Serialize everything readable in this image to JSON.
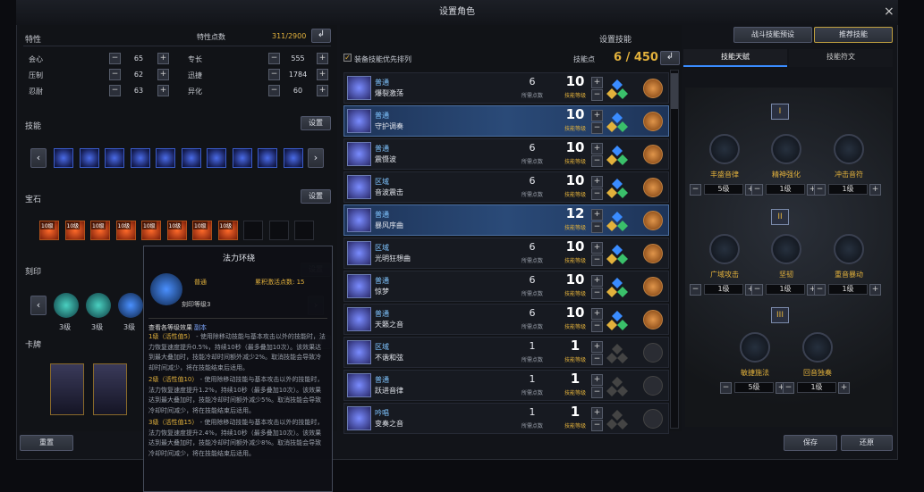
{
  "window": {
    "title": "设置角色",
    "close": "×"
  },
  "left": {
    "traits": {
      "title": "特性",
      "points_label": "特性点数",
      "points_value": "311/2900",
      "stats": [
        {
          "label": "会心",
          "value": "65"
        },
        {
          "label": "专长",
          "value": "555"
        },
        {
          "label": "压制",
          "value": "62"
        },
        {
          "label": "迅捷",
          "value": "1784"
        },
        {
          "label": "忍耐",
          "value": "63"
        },
        {
          "label": "异化",
          "value": "60"
        }
      ]
    },
    "skills": {
      "title": "技能",
      "button": "设置"
    },
    "gems": {
      "title": "宝石",
      "button": "设置",
      "labels": [
        "10级",
        "10级",
        "10级",
        "10级",
        "10级",
        "10级",
        "10级",
        "10级"
      ]
    },
    "engrave": {
      "title": "刻印",
      "button": "设置",
      "levels": [
        "3级",
        "3级",
        "3级"
      ]
    },
    "cards": {
      "title": "卡牌",
      "button": "设置"
    },
    "reset": "重置"
  },
  "tooltip": {
    "title": "法力环绕",
    "type": "普通",
    "points": "累积激活点数: 15",
    "level": "刻印等级3",
    "detail_link": "查看各等级效果",
    "detail_tag": "副本",
    "lines": [
      {
        "h": "1级（活性值5）",
        "t": " - 使用除移动技能与基本攻击以外的技能时，法力恢复速度提升0.5%，持续10秒（最多叠加10次）。该效果达到最大叠加时，技能冷却时间额外减少2%。取消技能会导致冷却时间减少，将在技能结束后适用。"
      },
      {
        "h": "2级（活性值10）",
        "t": " - 使用除移动技能与基本攻击以外的技能时，法力恢复速度提升1.2%，持续10秒（最多叠加10次）。该效果达到最大叠加时，技能冷却时间额外减少5%。取消技能会导致冷却时间减少，将在技能结束后适用。"
      },
      {
        "h": "3级（活性值15）",
        "t": " - 使用除移动技能与基本攻击以外的技能时，法力恢复速度提升2.4%，持续10秒（最多叠加10次）。该效果达到最大叠加时，技能冷却时间额外减少8%。取消技能会导致冷却时间减少，将在技能结束后适用。"
      }
    ]
  },
  "middle": {
    "title": "设置技能",
    "priority_label": "装备技能优先排列",
    "points_label": "技能点",
    "points_value": "6 / 450",
    "skills": [
      {
        "type": "普通",
        "name": "爆裂激荡",
        "points": "6",
        "level": "10",
        "coin": true
      },
      {
        "type": "普通",
        "name": "守护调奏",
        "points": "",
        "level": "10",
        "coin": true
      },
      {
        "type": "普通",
        "name": "震慑波",
        "points": "6",
        "level": "10",
        "coin": true
      },
      {
        "type": "区域",
        "name": "音波震击",
        "points": "6",
        "level": "10",
        "coin": true
      },
      {
        "type": "普通",
        "name": "暴风序曲",
        "points": "",
        "level": "12",
        "coin": true
      },
      {
        "type": "区域",
        "name": "光明狂想曲",
        "points": "6",
        "level": "10",
        "coin": true
      },
      {
        "type": "普通",
        "name": "惊梦",
        "points": "6",
        "level": "10",
        "coin": true
      },
      {
        "type": "普通",
        "name": "天籁之音",
        "points": "6",
        "level": "10",
        "coin": true
      },
      {
        "type": "区域",
        "name": "不谐和弦",
        "points": "1",
        "level": "1",
        "coin": false
      },
      {
        "type": "普通",
        "name": "跃进音律",
        "points": "1",
        "level": "1",
        "coin": false
      },
      {
        "type": "吟唱",
        "name": "变奏之音",
        "points": "1",
        "level": "1",
        "coin": false
      }
    ],
    "pts_label": "所需点数",
    "lv_label": "技能等级"
  },
  "right": {
    "buttons": {
      "preset": "战斗技能预设",
      "recommend": "推荐技能"
    },
    "tabs": {
      "talent": "技能天赋",
      "rune": "技能符文"
    },
    "tier1": [
      {
        "name": "丰盛音律",
        "lv": "5级"
      },
      {
        "name": "精神强化",
        "lv": "1级"
      },
      {
        "name": "冲击音符",
        "lv": "1级"
      }
    ],
    "tier2": [
      {
        "name": "广域攻击",
        "lv": "1级"
      },
      {
        "name": "坚韧",
        "lv": "1级"
      },
      {
        "name": "重音暴动",
        "lv": "1级"
      }
    ],
    "tier3": [
      {
        "name": "敏捷施法",
        "lv": "5级"
      },
      {
        "name": "回音独奏",
        "lv": "1级"
      }
    ],
    "tier_marks": [
      "I",
      "II",
      "III"
    ],
    "save": "保存",
    "restore": "还原"
  },
  "colors": {
    "gold": "#e2b13c",
    "accent": "#3a8cff"
  }
}
